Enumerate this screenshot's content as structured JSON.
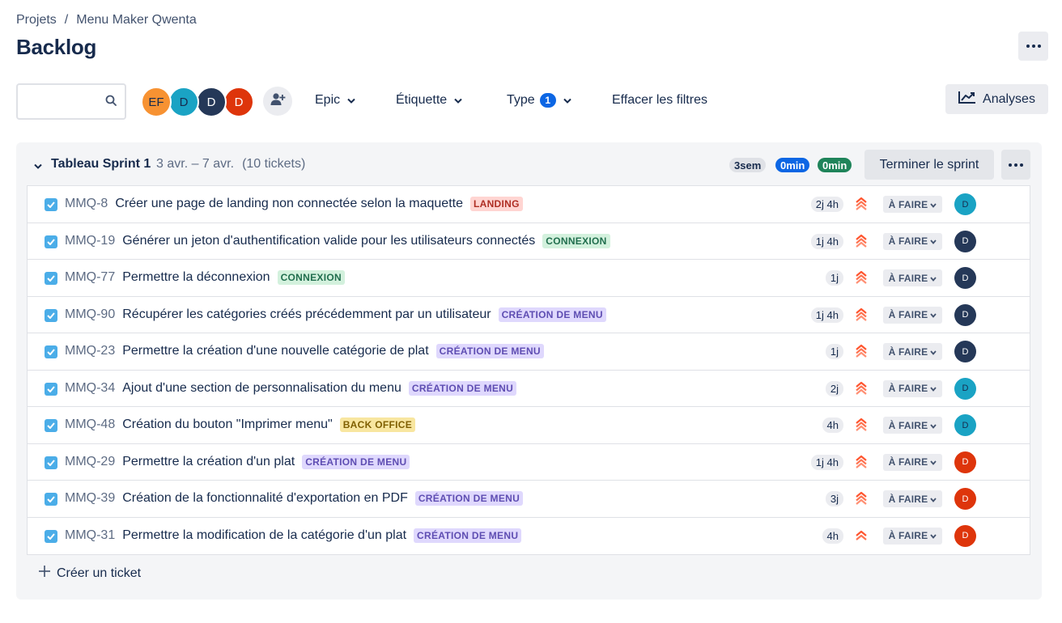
{
  "breadcrumb": {
    "projects": "Projets",
    "separator": "/",
    "project": "Menu Maker Qwenta"
  },
  "page": {
    "title": "Backlog"
  },
  "toolbar": {
    "search_placeholder": "",
    "avatars": [
      {
        "initials": "EF",
        "bg": "#f79232",
        "fg": "#172b4d"
      },
      {
        "initials": "D",
        "bg": "#1aa3c4",
        "fg": "#172b4d"
      },
      {
        "initials": "D",
        "bg": "#253858",
        "fg": "#ffffff"
      },
      {
        "initials": "D",
        "bg": "#de350b",
        "fg": "#ffffff"
      }
    ],
    "filters": {
      "epic": "Epic",
      "label": "Étiquette",
      "type": "Type",
      "type_count": "1",
      "clear": "Effacer les filtres"
    },
    "analytics": "Analyses"
  },
  "sprint": {
    "name": "Tableau Sprint 1",
    "dates": "3 avr. – 7 avr.",
    "ticket_count": "(10 tickets)",
    "estimates": {
      "todo": "3sem",
      "in_progress": "0min",
      "done": "0min"
    },
    "finish_label": "Terminer le sprint",
    "create_label": "Créer un ticket"
  },
  "colors": {
    "accent": "#0c66e4",
    "done": "#1f845a",
    "priority": "#ff5630",
    "task_icon": "#4bade8",
    "lozenges": {
      "LANDING": {
        "bg": "#ffd5d2",
        "fg": "#ae2e24"
      },
      "CONNEXION": {
        "bg": "#d3f1dd",
        "fg": "#216e4e"
      },
      "CRÉATION DE MENU": {
        "bg": "#dfd8fd",
        "fg": "#5e4db2"
      },
      "BACK OFFICE": {
        "bg": "#f8e6a0",
        "fg": "#7f5f01"
      }
    },
    "assignees": {
      "teal": "#1aa3c4",
      "navy": "#253858",
      "red": "#de350b"
    }
  },
  "issues": [
    {
      "key": "MMQ-8",
      "summary": "Créer une page de landing non connectée selon la maquette",
      "epic": "LANDING",
      "estimate": "2j 4h",
      "priority_icon": "highest-priority-icon",
      "status": "À FAIRE",
      "assignee": "D",
      "assignee_color": "teal"
    },
    {
      "key": "MMQ-19",
      "summary": "Générer un jeton d'authentification valide pour les utilisateurs connectés",
      "epic": "CONNEXION",
      "estimate": "1j 4h",
      "priority_icon": "highest-priority-icon",
      "status": "À FAIRE",
      "assignee": "D",
      "assignee_color": "navy"
    },
    {
      "key": "MMQ-77",
      "summary": "Permettre la déconnexion",
      "epic": "CONNEXION",
      "estimate": "1j",
      "priority_icon": "highest-priority-icon",
      "status": "À FAIRE",
      "assignee": "D",
      "assignee_color": "navy"
    },
    {
      "key": "MMQ-90",
      "summary": "Récupérer les catégories créés précédemment par un utilisateur",
      "epic": "CRÉATION DE MENU",
      "estimate": "1j 4h",
      "priority_icon": "highest-priority-icon",
      "status": "À FAIRE",
      "assignee": "D",
      "assignee_color": "navy"
    },
    {
      "key": "MMQ-23",
      "summary": "Permettre la création d'une nouvelle catégorie de plat",
      "epic": "CRÉATION DE MENU",
      "estimate": "1j",
      "priority_icon": "highest-priority-icon",
      "status": "À FAIRE",
      "assignee": "D",
      "assignee_color": "navy"
    },
    {
      "key": "MMQ-34",
      "summary": "Ajout d'une section de personnalisation du menu",
      "epic": "CRÉATION DE MENU",
      "estimate": "2j",
      "priority_icon": "highest-priority-icon",
      "status": "À FAIRE",
      "assignee": "D",
      "assignee_color": "teal"
    },
    {
      "key": "MMQ-48",
      "summary": "Création du bouton \"Imprimer menu\"",
      "epic": "BACK OFFICE",
      "estimate": "4h",
      "priority_icon": "highest-priority-icon",
      "status": "À FAIRE",
      "assignee": "D",
      "assignee_color": "teal"
    },
    {
      "key": "MMQ-29",
      "summary": "Permettre la création d'un plat",
      "epic": "CRÉATION DE MENU",
      "estimate": "1j 4h",
      "priority_icon": "highest-priority-icon",
      "status": "À FAIRE",
      "assignee": "D",
      "assignee_color": "red"
    },
    {
      "key": "MMQ-39",
      "summary": "Création de la fonctionnalité d'exportation en PDF",
      "epic": "CRÉATION DE MENU",
      "estimate": "3j",
      "priority_icon": "highest-priority-icon",
      "status": "À FAIRE",
      "assignee": "D",
      "assignee_color": "red"
    },
    {
      "key": "MMQ-31",
      "summary": "Permettre la modification de la catégorie d'un plat",
      "epic": "CRÉATION DE MENU",
      "estimate": "4h",
      "priority_icon": "high-priority-icon",
      "status": "À FAIRE",
      "assignee": "D",
      "assignee_color": "red"
    }
  ]
}
